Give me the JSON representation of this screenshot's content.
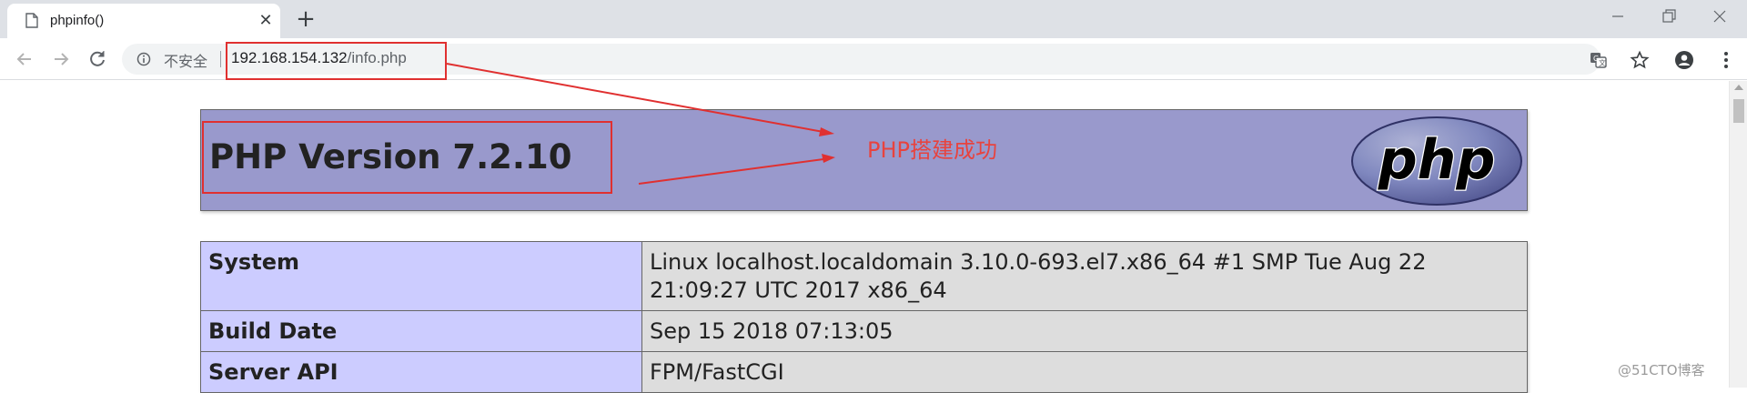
{
  "browser": {
    "tab": {
      "title": "phpinfo()"
    },
    "new_tab_symbol": "+",
    "close_symbol": "✕",
    "omnibox": {
      "security_label": "不安全",
      "url_host": "192.168.154.132",
      "url_path": "/info.php"
    },
    "icons": [
      "page-icon",
      "close-icon",
      "plus-icon",
      "minimize-icon",
      "restore-icon",
      "window-close-icon",
      "back-arrow-icon",
      "forward-arrow-icon",
      "reload-icon",
      "info-icon",
      "translate-icon",
      "star-icon",
      "account-icon",
      "menu-dots-icon"
    ]
  },
  "phpinfo": {
    "title": "PHP Version 7.2.10",
    "logo_text": "php",
    "rows": [
      {
        "key": "System",
        "value": "Linux localhost.localdomain 3.10.0-693.el7.x86_64 #1 SMP Tue Aug 22 21:09:27 UTC 2017 x86_64"
      },
      {
        "key": "Build Date",
        "value": "Sep 15 2018 07:13:05"
      },
      {
        "key": "Server API",
        "value": "FPM/FastCGI"
      }
    ]
  },
  "annotation": {
    "text": "PHP搭建成功",
    "color": "#e8433e"
  },
  "watermark": "@51CTO博客",
  "colors": {
    "header_bg": "#9999cc",
    "key_cell_bg": "#ccccff",
    "value_cell_bg": "#dddddd",
    "highlight_red": "#e03030"
  }
}
